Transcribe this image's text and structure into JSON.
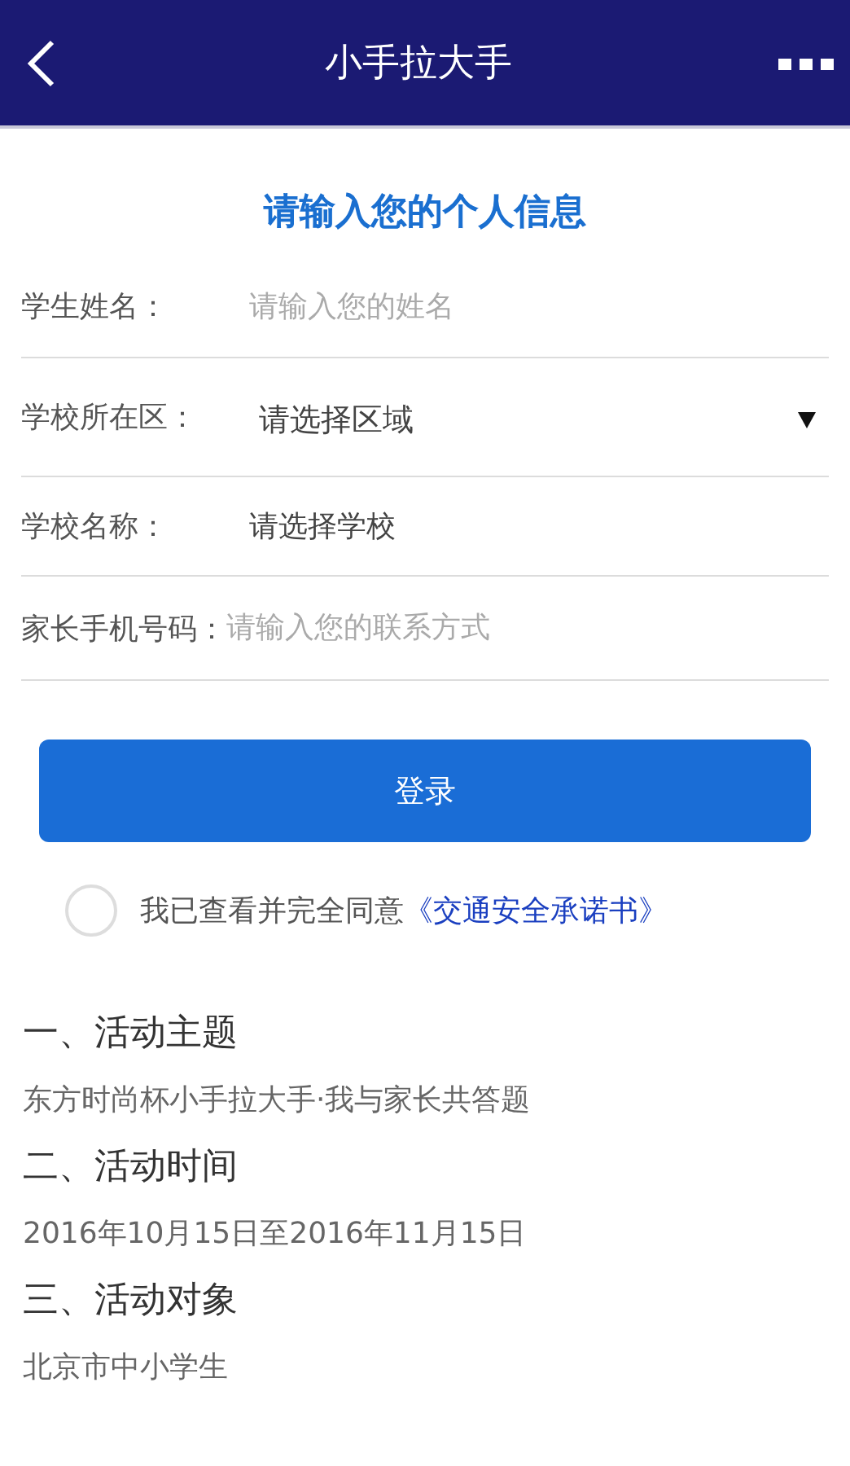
{
  "header": {
    "title": "小手拉大手"
  },
  "form": {
    "title": "请输入您的个人信息",
    "fields": [
      {
        "kind": "input",
        "label": "学生姓名：",
        "placeholder": "请输入您的姓名"
      },
      {
        "kind": "select",
        "label": "学校所在区：",
        "value": "请选择区域"
      },
      {
        "kind": "picker",
        "label": "学校名称：",
        "value": "请选择学校"
      },
      {
        "kind": "input",
        "label": "家长手机号码：",
        "placeholder": "请输入您的联系方式"
      }
    ]
  },
  "login_button": "登录",
  "agreement": {
    "checked": false,
    "text": "我已查看并完全同意",
    "link": "《交通安全承诺书》"
  },
  "sections": [
    {
      "heading": "一、活动主题",
      "body": "东方时尚杯小手拉大手·我与家长共答题"
    },
    {
      "heading": "二、活动时间",
      "body": "2016年10月15日至2016年11月15日"
    },
    {
      "heading": "三、活动对象",
      "body": "北京市中小学生"
    }
  ]
}
